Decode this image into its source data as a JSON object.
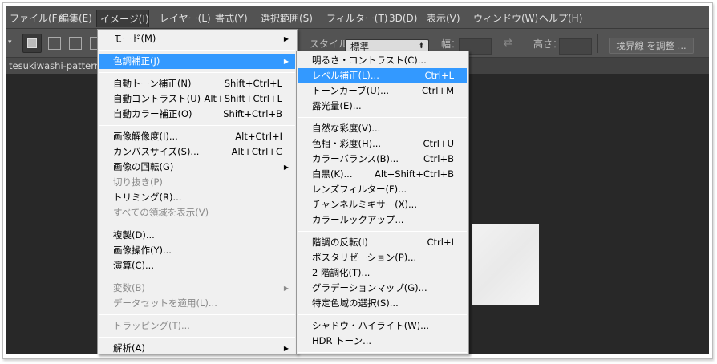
{
  "menubar": [
    "ファイル(F)",
    "編集(E)",
    "イメージ(I)",
    "レイヤー(L)",
    "書式(Y)",
    "選択範囲(S)",
    "フィルター(T)",
    "3D(D)",
    "表示(V)",
    "ウィンドウ(W)",
    "ヘルプ(H)"
  ],
  "active_menu": "イメージ(I)",
  "options": {
    "style_label": "スタイル：",
    "style_value": "標準",
    "width_label": "幅：",
    "height_label": "高さ：",
    "refine_button": "境界線 を調整 ..."
  },
  "document_tab": "tesukiwashi-pattern-",
  "image_menu": [
    {
      "label": "モード(M)",
      "submenu": true
    },
    {
      "sep": true
    },
    {
      "label": "色調補正(J)",
      "submenu": true,
      "highlighted": true
    },
    {
      "sep": true
    },
    {
      "label": "自動トーン補正(N)",
      "shortcut": "Shift+Ctrl+L"
    },
    {
      "label": "自動コントラスト(U)",
      "shortcut": "Alt+Shift+Ctrl+L"
    },
    {
      "label": "自動カラー補正(O)",
      "shortcut": "Shift+Ctrl+B"
    },
    {
      "sep": true
    },
    {
      "label": "画像解像度(I)...",
      "shortcut": "Alt+Ctrl+I"
    },
    {
      "label": "カンバスサイズ(S)...",
      "shortcut": "Alt+Ctrl+C"
    },
    {
      "label": "画像の回転(G)",
      "submenu": true
    },
    {
      "label": "切り抜き(P)",
      "disabled": true
    },
    {
      "label": "トリミング(R)..."
    },
    {
      "label": "すべての領域を表示(V)",
      "disabled": true
    },
    {
      "sep": true
    },
    {
      "label": "複製(D)..."
    },
    {
      "label": "画像操作(Y)..."
    },
    {
      "label": "演算(C)..."
    },
    {
      "sep": true
    },
    {
      "label": "変数(B)",
      "submenu": true,
      "disabled": true
    },
    {
      "label": "データセットを適用(L)...",
      "disabled": true
    },
    {
      "sep": true
    },
    {
      "label": "トラッピング(T)...",
      "disabled": true
    },
    {
      "sep": true
    },
    {
      "label": "解析(A)",
      "submenu": true
    }
  ],
  "adjustments_menu": [
    {
      "label": "明るさ・コントラスト(C)..."
    },
    {
      "label": "レベル補正(L)...",
      "shortcut": "Ctrl+L",
      "highlighted": true
    },
    {
      "label": "トーンカーブ(U)...",
      "shortcut": "Ctrl+M"
    },
    {
      "label": "露光量(E)..."
    },
    {
      "sep": true
    },
    {
      "label": "自然な彩度(V)..."
    },
    {
      "label": "色相・彩度(H)...",
      "shortcut": "Ctrl+U"
    },
    {
      "label": "カラーバランス(B)...",
      "shortcut": "Ctrl+B"
    },
    {
      "label": "白黒(K)...",
      "shortcut": "Alt+Shift+Ctrl+B"
    },
    {
      "label": "レンズフィルター(F)..."
    },
    {
      "label": "チャンネルミキサー(X)..."
    },
    {
      "label": "カラールックアップ..."
    },
    {
      "sep": true
    },
    {
      "label": "階調の反転(I)",
      "shortcut": "Ctrl+I"
    },
    {
      "label": "ポスタリゼーション(P)..."
    },
    {
      "label": "2 階調化(T)..."
    },
    {
      "label": "グラデーションマップ(G)..."
    },
    {
      "label": "特定色域の選択(S)..."
    },
    {
      "sep": true
    },
    {
      "label": "シャドウ・ハイライト(W)..."
    },
    {
      "label": "HDR トーン..."
    },
    {
      "sep": true
    }
  ],
  "colors": {
    "highlight": "#3399ff",
    "menu_bg": "#f0f0f0",
    "app_bg": "#535353",
    "canvas_bg": "#282828"
  }
}
